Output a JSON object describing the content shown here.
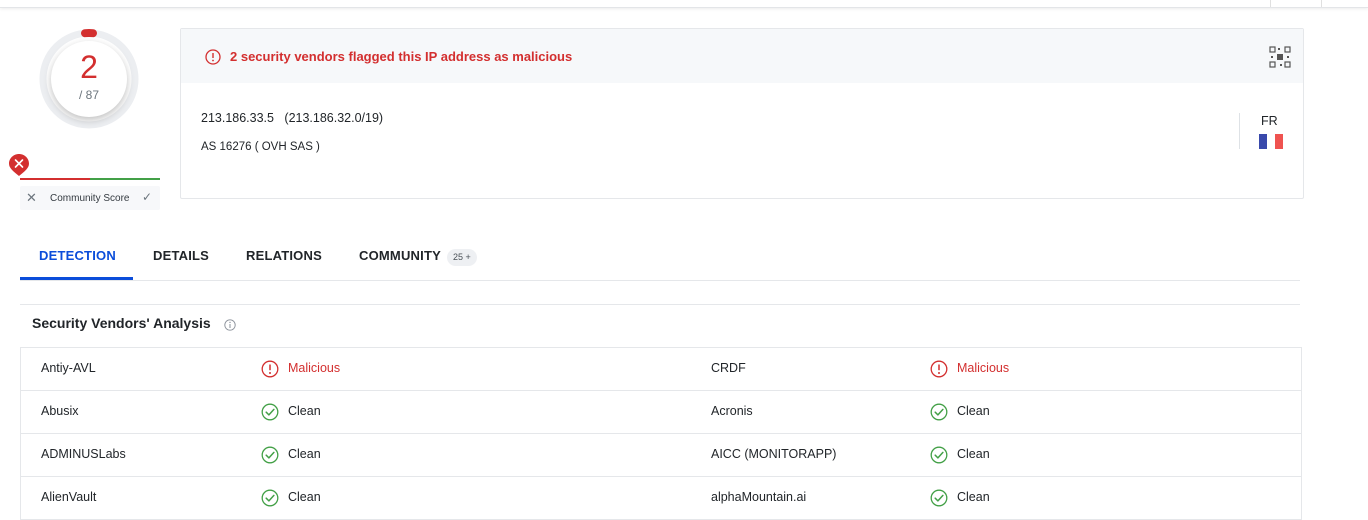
{
  "score": {
    "detections": "2",
    "total": "/ 87"
  },
  "community": {
    "label": "Community Score"
  },
  "header": {
    "alert": "2 security vendors flagged this IP address as malicious",
    "ip_line": "213.186.33.5   (213.186.32.0/19)",
    "as_line": "AS 16276 ( OVH SAS )",
    "country_code": "FR"
  },
  "tabs": [
    {
      "label": "DETECTION"
    },
    {
      "label": "DETAILS"
    },
    {
      "label": "RELATIONS"
    },
    {
      "label": "COMMUNITY",
      "badge": "25 +"
    }
  ],
  "section": {
    "title": "Security Vendors' Analysis"
  },
  "vendors": [
    {
      "left": {
        "name": "Antiy-AVL",
        "result": "Malicious"
      },
      "right": {
        "name": "CRDF",
        "result": "Malicious"
      }
    },
    {
      "left": {
        "name": "Abusix",
        "result": "Clean"
      },
      "right": {
        "name": "Acronis",
        "result": "Clean"
      }
    },
    {
      "left": {
        "name": "ADMINUSLabs",
        "result": "Clean"
      },
      "right": {
        "name": "AICC (MONITORAPP)",
        "result": "Clean"
      }
    },
    {
      "left": {
        "name": "AlienVault",
        "result": "Clean"
      },
      "right": {
        "name": "alphaMountain.ai",
        "result": "Clean"
      }
    }
  ],
  "colors": {
    "malicious": "#d32f2f",
    "clean": "#43a047",
    "accent": "#0b4dda"
  },
  "icons": {
    "alert": "alert-circle-icon",
    "qr": "qr-code-icon",
    "info": "info-icon",
    "malicious": "alert-circle-icon",
    "clean": "check-circle-icon"
  }
}
